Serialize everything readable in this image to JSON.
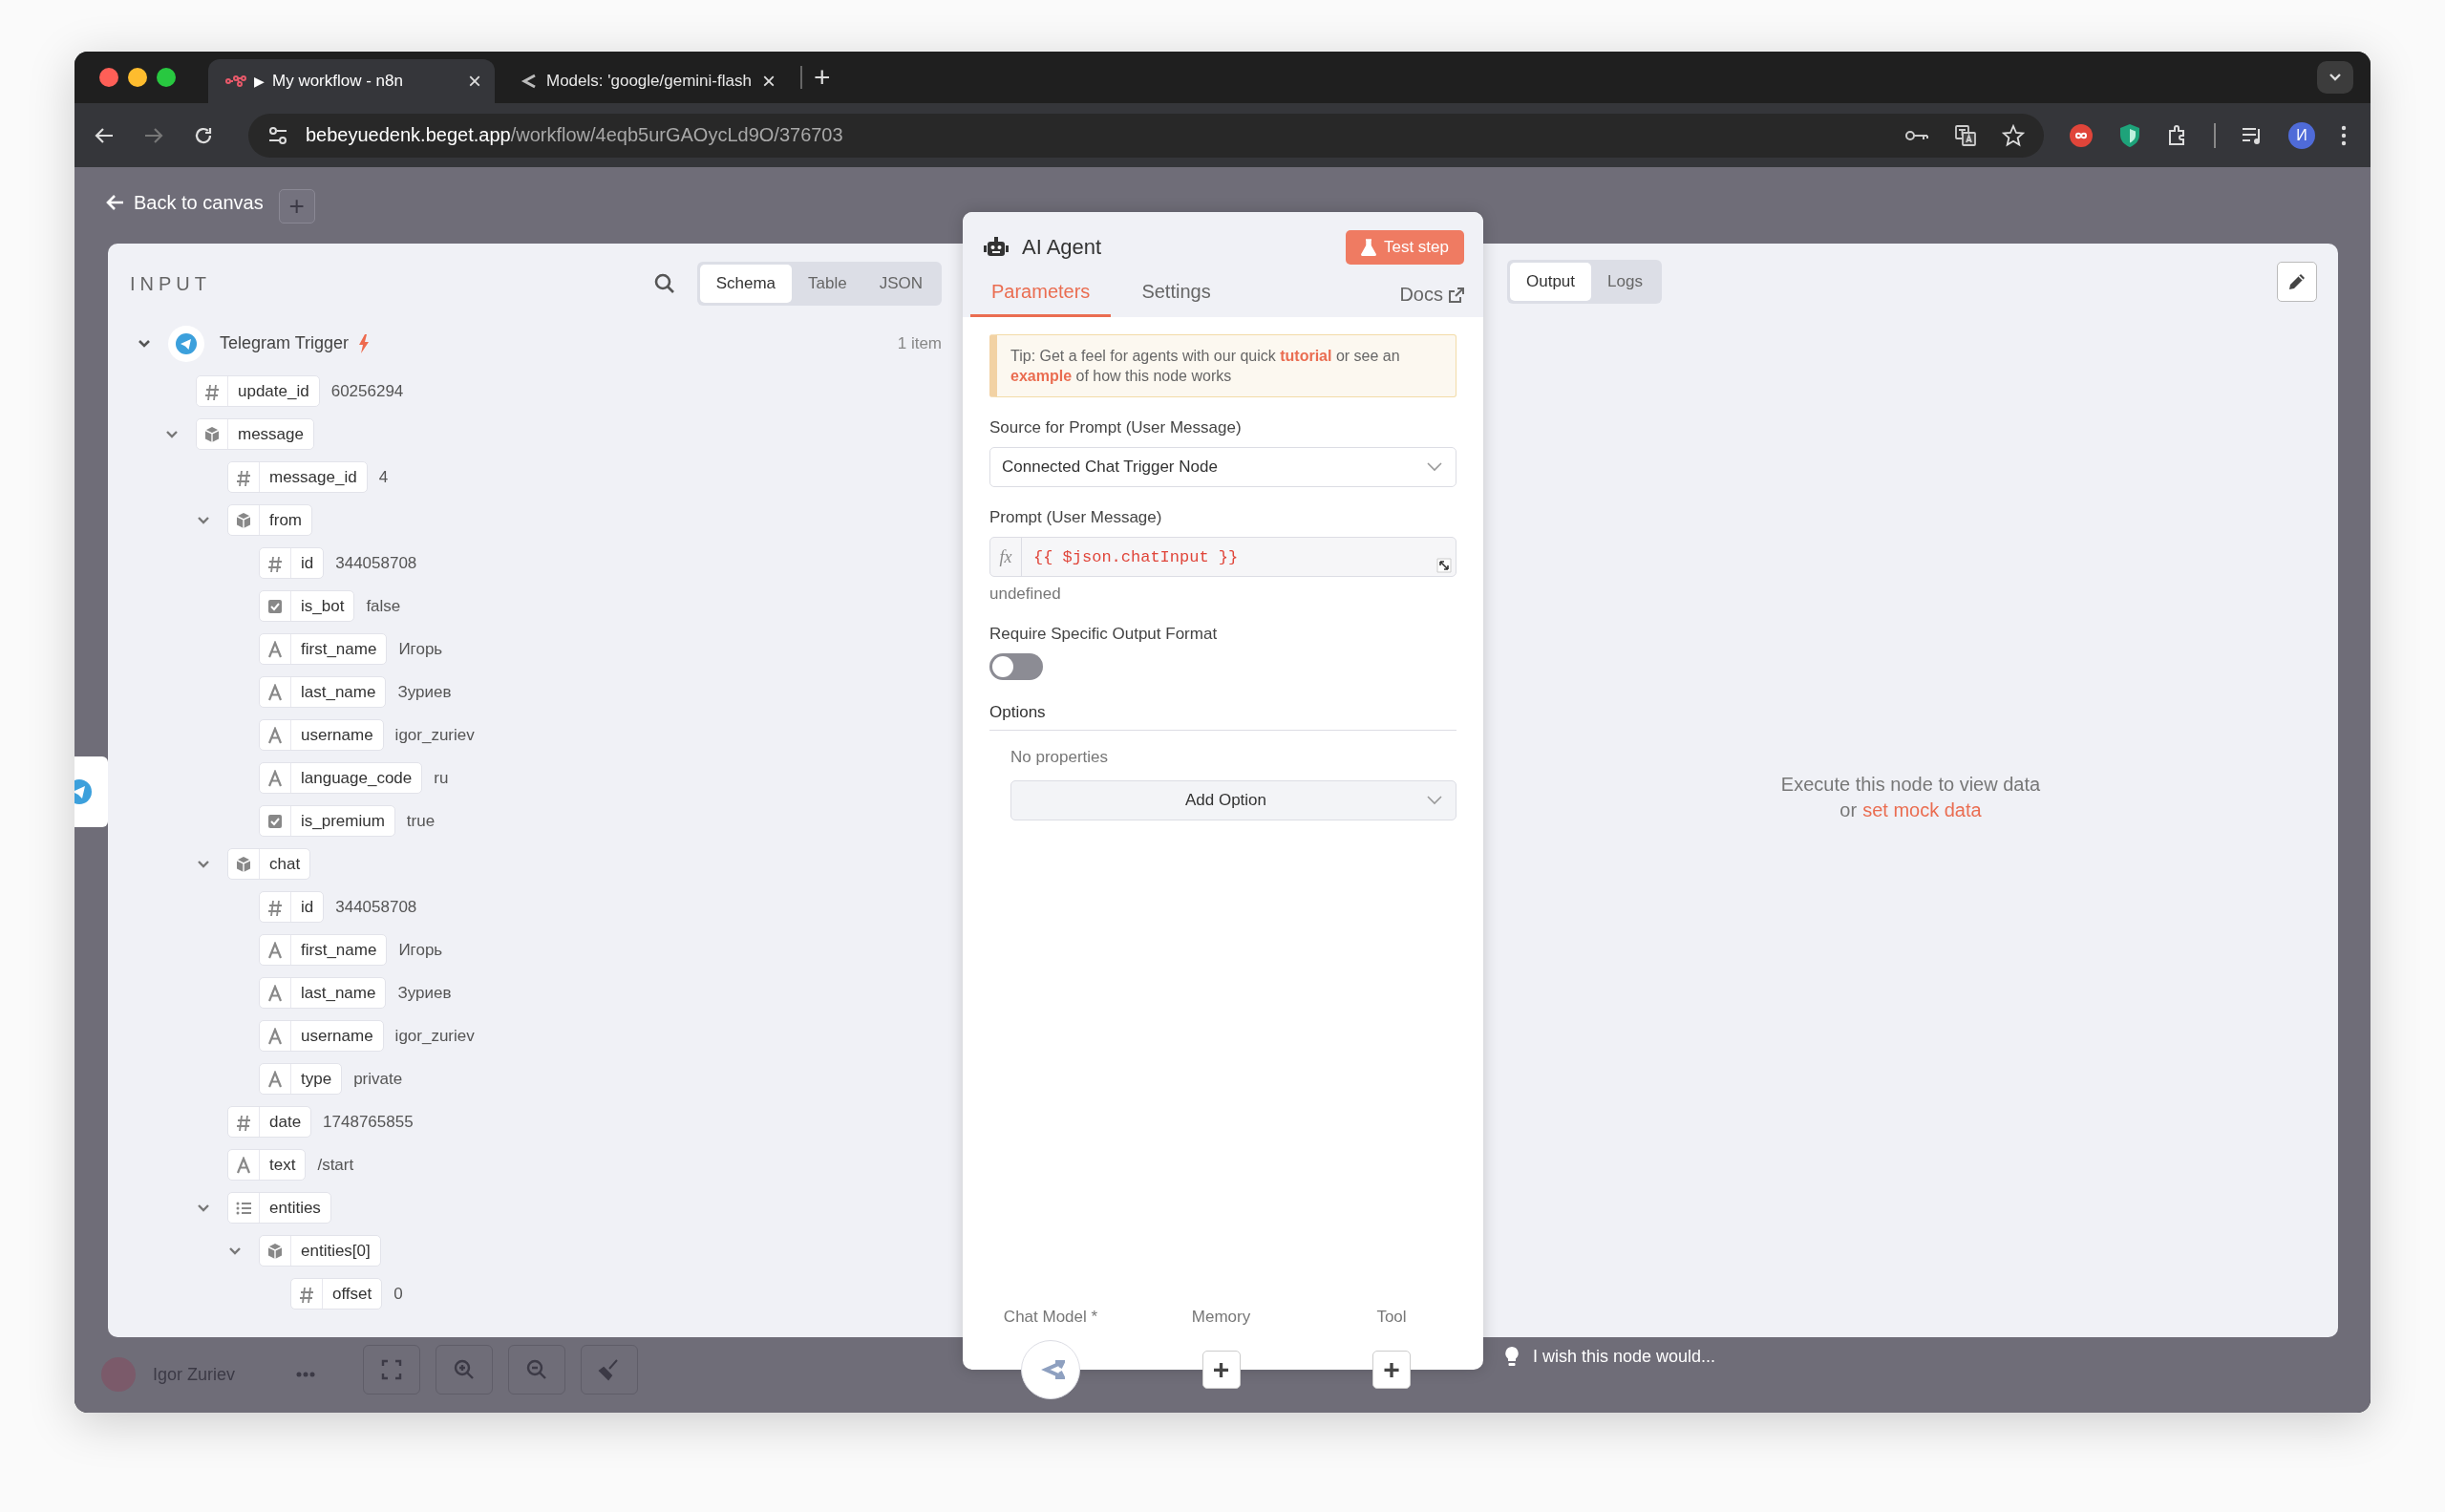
{
  "browser": {
    "tabs": [
      {
        "indicator": "▶",
        "title": "My workflow - n8n",
        "close": "×",
        "selected": true
      },
      {
        "title": "Models: 'google/gemini-flash",
        "close": "×",
        "selected": false
      }
    ],
    "new_tab": "+",
    "url": {
      "host": "bebeyuedenk.beget.app",
      "path": "/workflow/4eqb5urGAOycLd9O/376703"
    },
    "profile_initial": "И"
  },
  "canvas": {
    "back_label": "Back to canvas",
    "add_button": "+",
    "user_name": "Igor Zuriev"
  },
  "input_panel": {
    "title": "INPUT",
    "view_tabs": [
      {
        "label": "Schema",
        "selected": true
      },
      {
        "label": "Table",
        "selected": false
      },
      {
        "label": "JSON",
        "selected": false
      }
    ],
    "source": {
      "name": "Telegram Trigger",
      "count": "1 item",
      "expanded": true,
      "children": [
        {
          "key": "update_id",
          "kind": "number",
          "value": "60256294"
        },
        {
          "key": "message",
          "kind": "object",
          "expanded": true,
          "children": [
            {
              "key": "message_id",
              "kind": "number",
              "value": "4"
            },
            {
              "key": "from",
              "kind": "object",
              "expanded": true,
              "children": [
                {
                  "key": "id",
                  "kind": "number",
                  "value": "344058708"
                },
                {
                  "key": "is_bot",
                  "kind": "boolean",
                  "value": "false"
                },
                {
                  "key": "first_name",
                  "kind": "string",
                  "value": "Игорь"
                },
                {
                  "key": "last_name",
                  "kind": "string",
                  "value": "Зуриев"
                },
                {
                  "key": "username",
                  "kind": "string",
                  "value": "igor_zuriev"
                },
                {
                  "key": "language_code",
                  "kind": "string",
                  "value": "ru"
                },
                {
                  "key": "is_premium",
                  "kind": "boolean",
                  "value": "true"
                }
              ]
            },
            {
              "key": "chat",
              "kind": "object",
              "expanded": true,
              "children": [
                {
                  "key": "id",
                  "kind": "number",
                  "value": "344058708"
                },
                {
                  "key": "first_name",
                  "kind": "string",
                  "value": "Игорь"
                },
                {
                  "key": "last_name",
                  "kind": "string",
                  "value": "Зуриев"
                },
                {
                  "key": "username",
                  "kind": "string",
                  "value": "igor_zuriev"
                },
                {
                  "key": "type",
                  "kind": "string",
                  "value": "private"
                }
              ]
            },
            {
              "key": "date",
              "kind": "number",
              "value": "1748765855"
            },
            {
              "key": "text",
              "kind": "string",
              "value": "/start"
            },
            {
              "key": "entities",
              "kind": "array",
              "expanded": true,
              "children": [
                {
                  "key": "entities[0]",
                  "kind": "object",
                  "expanded": true,
                  "children": [
                    {
                      "key": "offset",
                      "kind": "number",
                      "value": "0"
                    }
                  ]
                }
              ]
            }
          ]
        }
      ]
    }
  },
  "node_panel": {
    "title": "AI Agent",
    "test_button": "Test step",
    "tabs": [
      {
        "label": "Parameters",
        "selected": true
      },
      {
        "label": "Settings",
        "selected": false
      }
    ],
    "docs_link": "Docs",
    "tip": [
      {
        "kind": "text",
        "text": "Tip: Get a feel for agents with our quick "
      },
      {
        "kind": "link",
        "text": "tutorial"
      },
      {
        "kind": "text",
        "text": " or see an "
      },
      {
        "kind": "link",
        "text": "example"
      },
      {
        "kind": "text",
        "text": " of how this node works"
      }
    ],
    "fields": [
      {
        "kind": "select",
        "label": "Source for Prompt (User Message)",
        "value": "Connected Chat Trigger Node"
      },
      {
        "kind": "expression",
        "label": "Prompt (User Message)",
        "prefix": "fx",
        "value": "{{ $json.chatInput }}",
        "hint": "undefined"
      },
      {
        "kind": "toggle",
        "label": "Require Specific Output Format",
        "on": false
      }
    ],
    "options": {
      "title": "Options",
      "empty_text": "No properties",
      "add_button": "Add Option"
    },
    "connectors": [
      {
        "label": "Chat Model *",
        "kind": "connected"
      },
      {
        "label": "Memory",
        "kind": "add",
        "button": "+"
      },
      {
        "label": "Tool",
        "kind": "add",
        "button": "+"
      }
    ]
  },
  "output_panel": {
    "tabs": [
      {
        "label": "Output",
        "selected": true
      },
      {
        "label": "Logs",
        "selected": false
      }
    ],
    "empty_text": "Execute this node to view data",
    "mock_prefix": "or",
    "mock_link": "set mock data"
  },
  "feedback": {
    "placeholder": "I wish this node would..."
  }
}
